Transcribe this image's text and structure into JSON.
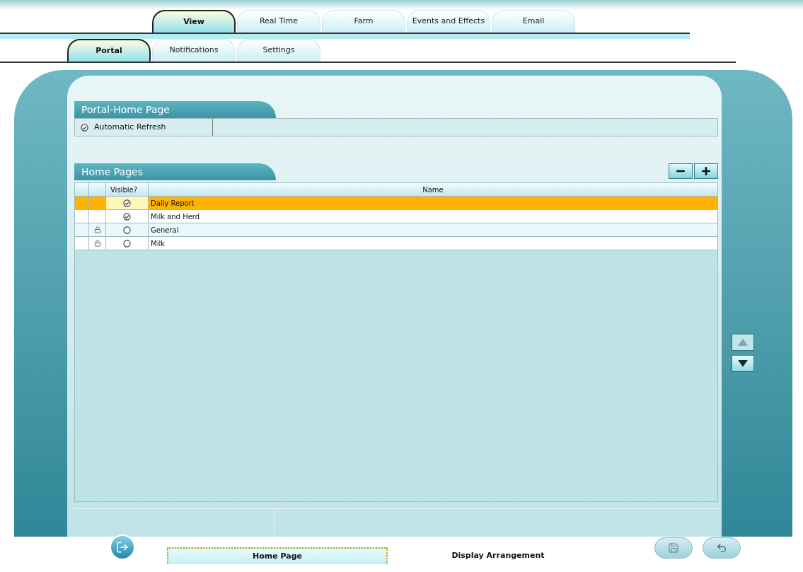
{
  "main_tabs": [
    {
      "label": "View",
      "selected": true
    },
    {
      "label": "Real Time",
      "selected": false
    },
    {
      "label": "Farm",
      "selected": false
    },
    {
      "label": "Events and Effects",
      "selected": false
    },
    {
      "label": "Email",
      "selected": false
    }
  ],
  "sub_tabs": [
    {
      "label": "Portal",
      "selected": true
    },
    {
      "label": "Notifications",
      "selected": false
    },
    {
      "label": "Settings",
      "selected": false
    }
  ],
  "portal_section": {
    "title": "Portal-Home Page",
    "option": {
      "label": "Automatic Refresh",
      "checked": true
    }
  },
  "home_pages": {
    "title": "Home Pages",
    "columns": [
      "Visible?",
      "Name"
    ],
    "rows": [
      {
        "visible": true,
        "locked": false,
        "selected": true,
        "name": "Daily Report"
      },
      {
        "visible": true,
        "locked": false,
        "selected": false,
        "name": "Milk and Herd"
      },
      {
        "visible": false,
        "locked": true,
        "selected": false,
        "name": "General"
      },
      {
        "visible": false,
        "locked": true,
        "selected": false,
        "name": "Milk"
      }
    ]
  },
  "move_buttons": [
    {
      "kind": "up",
      "disabled": true
    },
    {
      "kind": "down",
      "disabled": false
    }
  ],
  "bottom_tabs": [
    {
      "label": "Home Page",
      "selected": true
    },
    {
      "label": "Display Arrangement",
      "selected": false
    }
  ]
}
